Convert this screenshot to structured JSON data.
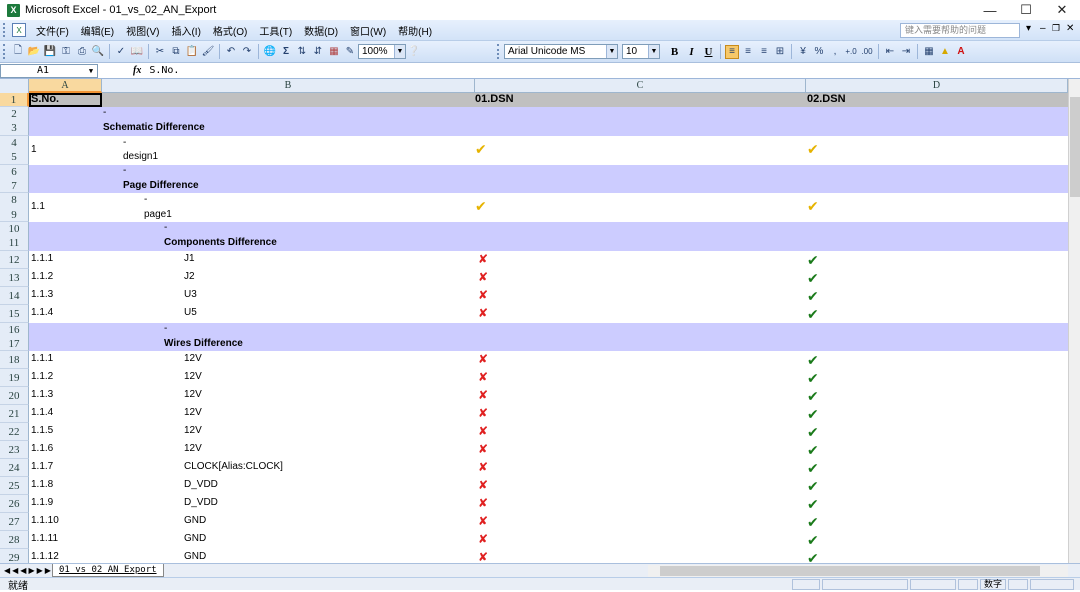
{
  "window": {
    "title": "Microsoft Excel - 01_vs_02_AN_Export",
    "icon_label": "X"
  },
  "menu": {
    "items": [
      "文件(F)",
      "编辑(E)",
      "视图(V)",
      "插入(I)",
      "格式(O)",
      "工具(T)",
      "数据(D)",
      "窗口(W)",
      "帮助(H)"
    ],
    "help_placeholder": "键入需要帮助的问题"
  },
  "toolbar": {
    "zoom": "100%",
    "font": "Arial Unicode MS",
    "font_size": "10",
    "bold": "B",
    "italic": "I",
    "underline": "U"
  },
  "formula": {
    "name_box": "A1",
    "fx": "fx",
    "value": "S.No."
  },
  "columns": [
    "A",
    "B",
    "C",
    "D"
  ],
  "rows": [
    {
      "num": [
        "1"
      ],
      "type": "header",
      "a": "S.No.",
      "b": "",
      "c": "01.DSN",
      "d": "02.DSN"
    },
    {
      "num": [
        "2",
        "3"
      ],
      "type": "section",
      "dash": "-",
      "title": "Schematic Difference",
      "indent": 0
    },
    {
      "num": [
        "4",
        "5"
      ],
      "type": "item2",
      "a": "1",
      "dash": "-",
      "b": "design1",
      "indent": 1,
      "c": "partial",
      "d": "partial"
    },
    {
      "num": [
        "6",
        "7"
      ],
      "type": "section",
      "dash": "-",
      "title": "Page Difference",
      "indent": 1
    },
    {
      "num": [
        "8",
        "9"
      ],
      "type": "item2",
      "a": "1.1",
      "dash": "-",
      "b": "page1",
      "indent": 2,
      "c": "partial",
      "d": "partial"
    },
    {
      "num": [
        "10",
        "11"
      ],
      "type": "section",
      "dash": "-",
      "title": "Components Difference",
      "indent": 3
    },
    {
      "num": [
        "12"
      ],
      "type": "item",
      "a": "1.1.1",
      "b": "J1",
      "c": "no",
      "d": "yes"
    },
    {
      "num": [
        "13"
      ],
      "type": "item",
      "a": "1.1.2",
      "b": "J2",
      "c": "no",
      "d": "yes"
    },
    {
      "num": [
        "14"
      ],
      "type": "item",
      "a": "1.1.3",
      "b": "U3",
      "c": "no",
      "d": "yes"
    },
    {
      "num": [
        "15"
      ],
      "type": "item",
      "a": "1.1.4",
      "b": "U5",
      "c": "no",
      "d": "yes"
    },
    {
      "num": [
        "16",
        "17"
      ],
      "type": "section",
      "dash": "-",
      "title": "Wires Difference",
      "indent": 3
    },
    {
      "num": [
        "18"
      ],
      "type": "item",
      "a": "1.1.1",
      "b": "12V",
      "c": "no",
      "d": "yes"
    },
    {
      "num": [
        "19"
      ],
      "type": "item",
      "a": "1.1.2",
      "b": "12V",
      "c": "no",
      "d": "yes"
    },
    {
      "num": [
        "20"
      ],
      "type": "item",
      "a": "1.1.3",
      "b": "12V",
      "c": "no",
      "d": "yes"
    },
    {
      "num": [
        "21"
      ],
      "type": "item",
      "a": "1.1.4",
      "b": "12V",
      "c": "no",
      "d": "yes"
    },
    {
      "num": [
        "22"
      ],
      "type": "item",
      "a": "1.1.5",
      "b": "12V",
      "c": "no",
      "d": "yes"
    },
    {
      "num": [
        "23"
      ],
      "type": "item",
      "a": "1.1.6",
      "b": "12V",
      "c": "no",
      "d": "yes"
    },
    {
      "num": [
        "24"
      ],
      "type": "item",
      "a": "1.1.7",
      "b": "CLOCK[Alias:CLOCK]",
      "c": "no",
      "d": "yes"
    },
    {
      "num": [
        "25"
      ],
      "type": "item",
      "a": "1.1.8",
      "b": "D_VDD",
      "c": "no",
      "d": "yes"
    },
    {
      "num": [
        "26"
      ],
      "type": "item",
      "a": "1.1.9",
      "b": "D_VDD",
      "c": "no",
      "d": "yes"
    },
    {
      "num": [
        "27"
      ],
      "type": "item",
      "a": "1.1.10",
      "b": "GND",
      "c": "no",
      "d": "yes"
    },
    {
      "num": [
        "28"
      ],
      "type": "item",
      "a": "1.1.11",
      "b": "GND",
      "c": "no",
      "d": "yes"
    },
    {
      "num": [
        "29"
      ],
      "type": "item",
      "a": "1.1.12",
      "b": "GND",
      "c": "no",
      "d": "yes"
    }
  ],
  "marks": {
    "yes": "✔",
    "no": "✘",
    "partial": "✔"
  },
  "sheet_tab": "01_vs_02_AN_Export",
  "status": {
    "ready": "就绪",
    "num": "数字"
  }
}
